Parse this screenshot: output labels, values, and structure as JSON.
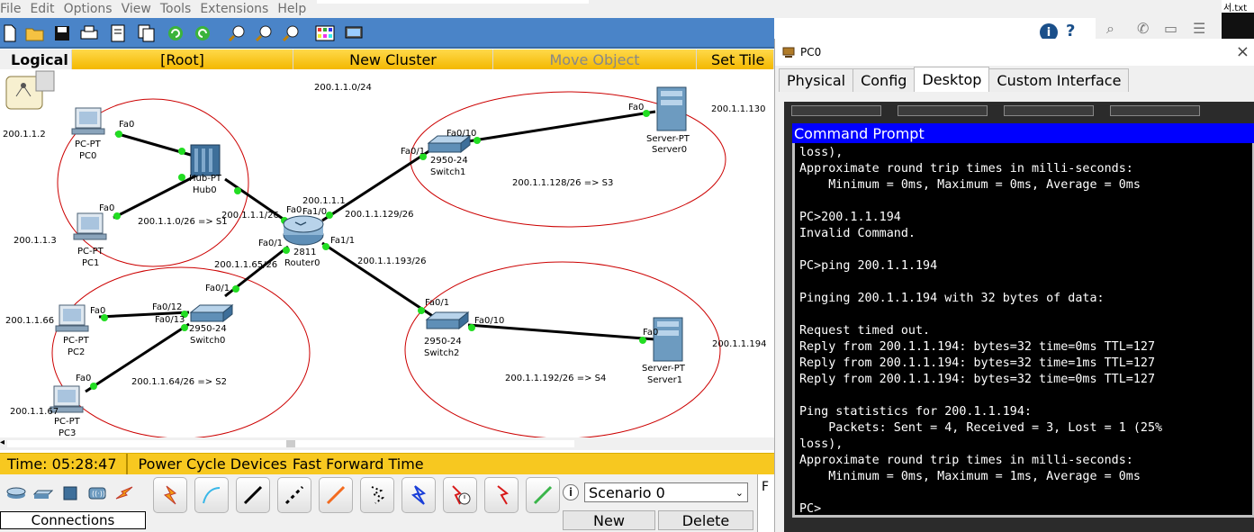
{
  "menu": [
    "File",
    "Edit",
    "Options",
    "View",
    "Tools",
    "Extensions",
    "Help"
  ],
  "right_strip_file": "서.txt",
  "tabs": {
    "logical": "Logical",
    "root": "[Root]",
    "new_cluster": "New Cluster",
    "move_object": "Move Object",
    "set_tiled": "Set Tile"
  },
  "topology": {
    "network_label": "200.1.1.0/24",
    "devices": [
      {
        "id": "pc0",
        "type": "PC-PT",
        "name": "PC0",
        "ip": "200.1.1.2"
      },
      {
        "id": "pc1",
        "type": "PC-PT",
        "name": "PC1",
        "ip": "200.1.1.3"
      },
      {
        "id": "pc2",
        "type": "PC-PT",
        "name": "PC2",
        "ip": "200.1.1.66"
      },
      {
        "id": "pc3",
        "type": "PC-PT",
        "name": "PC3",
        "ip": "200.1.1.67"
      },
      {
        "id": "hub0",
        "type": "Hub-PT",
        "name": "Hub0"
      },
      {
        "id": "router0",
        "type": "2811",
        "name": "Router0"
      },
      {
        "id": "switch0",
        "type": "2950-24",
        "name": "Switch0"
      },
      {
        "id": "switch1",
        "type": "2950-24",
        "name": "Switch1"
      },
      {
        "id": "switch2",
        "type": "2950-24",
        "name": "Switch2"
      },
      {
        "id": "server0",
        "type": "Server-PT",
        "name": "Server0",
        "ip": "200.1.1.130"
      },
      {
        "id": "server1",
        "type": "Server-PT",
        "name": "Server1",
        "ip": "200.1.1.194"
      }
    ],
    "port_labels": {
      "pc0_fa0": "Fa0",
      "pc1_fa0": "Fa0",
      "pc2_fa0": "Fa0",
      "pc3_fa0": "Fa0",
      "server0_fa0": "Fa0",
      "server1_fa0": "Fa0",
      "switch1_fa01": "Fa0/1",
      "switch1_fa010": "Fa0/10",
      "switch2_fa01": "Fa0/1",
      "switch2_fa010": "Fa0/10",
      "switch0_fa01": "Fa0/1",
      "switch0_fa012": "Fa0/12",
      "switch0_fa013": "Fa0/13",
      "router_fa0": "Fa0",
      "router_fa10": "Fa1/0",
      "router_fa01": "Fa0/1",
      "router_fa11": "Fa1/1"
    },
    "addr_labels": {
      "router_fa00_ip": "200.1.1.1/26",
      "router_fa10_ip_a": "200.1.1.1",
      "router_fa10_ip_b": "200.1.1.129/26",
      "router_fa01_ip": "200.1.1.65/26",
      "router_fa11_ip": "200.1.1.193/26"
    },
    "subnets": {
      "s1": "200.1.1.0/26 => S1",
      "s2": "200.1.1.64/26 => S2",
      "s3": "200.1.1.128/26 => S3",
      "s4": "200.1.1.192/26 => S4"
    }
  },
  "status": {
    "time": "Time: 05:28:47",
    "power_cycle": "Power Cycle Devices",
    "fast_forward": "Fast Forward Time"
  },
  "bottom": {
    "connections_label": "Connections",
    "scenario": "Scenario 0",
    "new_label": "New",
    "delete_label": "Delete",
    "f_label": "F"
  },
  "pc_window": {
    "title": "PC0",
    "tabs": [
      "Physical",
      "Config",
      "Desktop",
      "Custom Interface"
    ],
    "active_tab": "Desktop",
    "cmd_title": "Command Prompt",
    "lines": [
      "loss),",
      "Approximate round trip times in milli-seconds:",
      "    Minimum = 0ms, Maximum = 0ms, Average = 0ms",
      "",
      "PC>200.1.1.194",
      "Invalid Command.",
      "",
      "PC>ping 200.1.1.194",
      "",
      "Pinging 200.1.1.194 with 32 bytes of data:",
      "",
      "Request timed out.",
      "Reply from 200.1.1.194: bytes=32 time=0ms TTL=127",
      "Reply from 200.1.1.194: bytes=32 time=1ms TTL=127",
      "Reply from 200.1.1.194: bytes=32 time=0ms TTL=127",
      "",
      "Ping statistics for 200.1.1.194:",
      "    Packets: Sent = 4, Received = 3, Lost = 1 (25%",
      "loss),",
      "Approximate round trip times in milli-seconds:",
      "    Minimum = 0ms, Maximum = 1ms, Average = 0ms",
      "",
      "PC>"
    ]
  },
  "colors": {
    "toolbar_blue": "#4a84c8",
    "tab_yellow": "#f3b800",
    "status_yellow": "#f7c820",
    "link_green": "#22dd22",
    "ellipse_red": "#cc0000",
    "cmd_title_blue": "#0000ff"
  }
}
